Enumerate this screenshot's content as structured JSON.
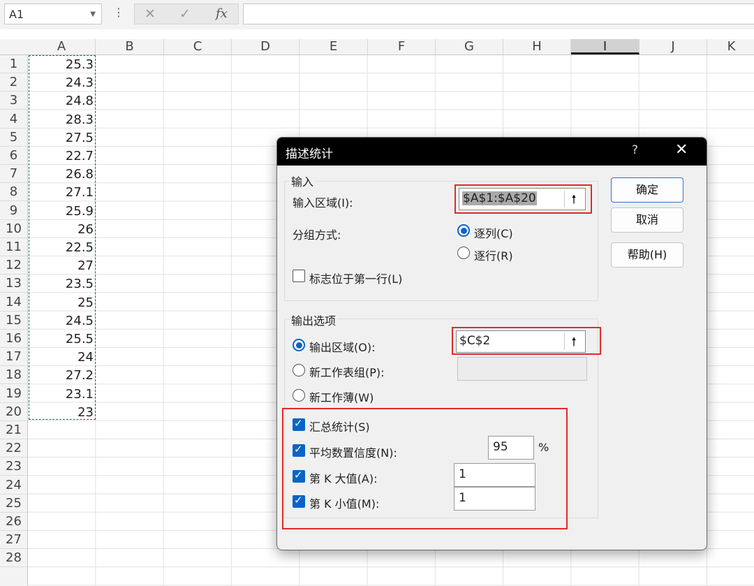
{
  "formula_bar": {
    "name_box": "A1",
    "more_icon": "⋮",
    "cancel_icon": "✕",
    "enter_icon": "✓",
    "fx_icon": "fx",
    "formula": ""
  },
  "sheet": {
    "columns": [
      "A",
      "B",
      "C",
      "D",
      "E",
      "F",
      "G",
      "H",
      "I",
      "J",
      "K"
    ],
    "selected_column": "I",
    "rows": [
      "1",
      "2",
      "3",
      "4",
      "5",
      "6",
      "7",
      "8",
      "9",
      "10",
      "11",
      "12",
      "13",
      "14",
      "15",
      "16",
      "17",
      "18",
      "19",
      "20",
      "21",
      "22",
      "23",
      "24",
      "25",
      "26",
      "27",
      "28"
    ],
    "column_a_values": [
      "25.3",
      "24.3",
      "24.8",
      "28.3",
      "27.5",
      "22.7",
      "26.8",
      "27.1",
      "25.9",
      "26",
      "22.5",
      "27",
      "23.5",
      "25",
      "24.5",
      "25.5",
      "24",
      "27.2",
      "23.1",
      "23"
    ]
  },
  "dialog": {
    "title": "描述统计",
    "help_icon": "?",
    "close_icon": "✕",
    "input_group": {
      "title": "输入",
      "range_label": "输入区域(I):",
      "range_value": "$A$1:$A$20",
      "collapse_icon": "🠕",
      "grouping_label": "分组方式:",
      "by_column_label": "逐列(C)",
      "by_row_label": "逐行(R)",
      "grouping_selected": "逐列(C)",
      "labels_first_row_label": "标志位于第一行(L)",
      "labels_first_row_checked": false
    },
    "output_group": {
      "title": "输出选项",
      "output_range_label": "输出区域(O):",
      "output_range_value": "$C$2",
      "new_sheet_label": "新工作表组(P):",
      "new_workbook_label": "新工作薄(W)",
      "output_selected": "输出区域(O):",
      "summary_label": "汇总统计(S)",
      "confidence_label": "平均数置信度(N):",
      "confidence_value": "95",
      "percent_sign": "%",
      "kth_largest_label": "第 K 大值(A):",
      "kth_largest_value": "1",
      "kth_smallest_label": "第 K 小值(M):",
      "kth_smallest_value": "1",
      "checked": [
        true,
        true,
        true,
        true
      ]
    },
    "buttons": {
      "ok": "确定",
      "cancel": "取消",
      "help": "帮助(H)"
    }
  },
  "colors": {
    "accent": "#0a64c8",
    "highlight_box": "#e02a2a",
    "marquee": "#1f6b45"
  }
}
